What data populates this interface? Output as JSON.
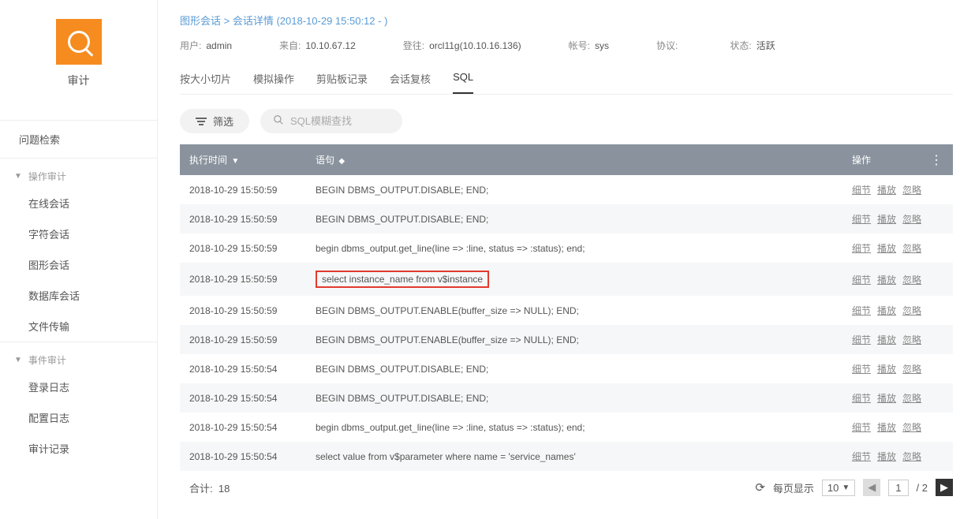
{
  "sidebar": {
    "brand": "审计",
    "top_item": "问题检索",
    "section1": {
      "title": "操作审计",
      "items": [
        "在线会话",
        "字符会话",
        "图形会话",
        "数据库会话",
        "文件传输"
      ]
    },
    "section2": {
      "title": "事件审计",
      "items": [
        "登录日志",
        "配置日志",
        "审计记录"
      ]
    }
  },
  "breadcrumb": {
    "root": "图形会话",
    "sep": ">",
    "detail": "会话详情 (2018-10-29 15:50:12 - )"
  },
  "info": {
    "user": {
      "label": "用户:",
      "value": "admin"
    },
    "from": {
      "label": "来自:",
      "value": "10.10.67.12"
    },
    "login": {
      "label": "登往:",
      "value": "orcl11g(10.10.16.136)"
    },
    "acct": {
      "label": "帐号:",
      "value": "sys"
    },
    "proto": {
      "label": "协议:",
      "value": ""
    },
    "status": {
      "label": "状态:",
      "value": "活跃"
    }
  },
  "tabs": [
    "按大小切片",
    "模拟操作",
    "剪贴板记录",
    "会话复核",
    "SQL"
  ],
  "active_tab": "SQL",
  "filter_label": "筛选",
  "search_placeholder": "SQL模糊查找",
  "table": {
    "headers": {
      "time": "执行时间",
      "stmt": "语句",
      "actions": "操作"
    },
    "action_labels": {
      "detail": "细节",
      "play": "播放",
      "ignore": "忽略"
    },
    "rows": [
      {
        "time": "2018-10-29 15:50:59",
        "sql": "BEGIN DBMS_OUTPUT.DISABLE; END;",
        "highlight": false
      },
      {
        "time": "2018-10-29 15:50:59",
        "sql": "BEGIN DBMS_OUTPUT.DISABLE; END;",
        "highlight": false
      },
      {
        "time": "2018-10-29 15:50:59",
        "sql": "begin dbms_output.get_line(line => :line, status => :status); end;",
        "highlight": false
      },
      {
        "time": "2018-10-29 15:50:59",
        "sql": "select instance_name from v$instance",
        "highlight": true
      },
      {
        "time": "2018-10-29 15:50:59",
        "sql": "BEGIN DBMS_OUTPUT.ENABLE(buffer_size => NULL); END;",
        "highlight": false
      },
      {
        "time": "2018-10-29 15:50:59",
        "sql": "BEGIN DBMS_OUTPUT.ENABLE(buffer_size => NULL); END;",
        "highlight": false
      },
      {
        "time": "2018-10-29 15:50:54",
        "sql": "BEGIN DBMS_OUTPUT.DISABLE; END;",
        "highlight": false
      },
      {
        "time": "2018-10-29 15:50:54",
        "sql": "BEGIN DBMS_OUTPUT.DISABLE; END;",
        "highlight": false
      },
      {
        "time": "2018-10-29 15:50:54",
        "sql": "begin dbms_output.get_line(line => :line, status => :status); end;",
        "highlight": false
      },
      {
        "time": "2018-10-29 15:50:54",
        "sql": "select value from v$parameter where name = 'service_names'",
        "highlight": false
      }
    ]
  },
  "footer": {
    "total_label": "合计:",
    "total_value": "18",
    "per_page_label": "每页显示",
    "per_page_value": "10",
    "current_page": "1",
    "total_pages": "/ 2"
  }
}
